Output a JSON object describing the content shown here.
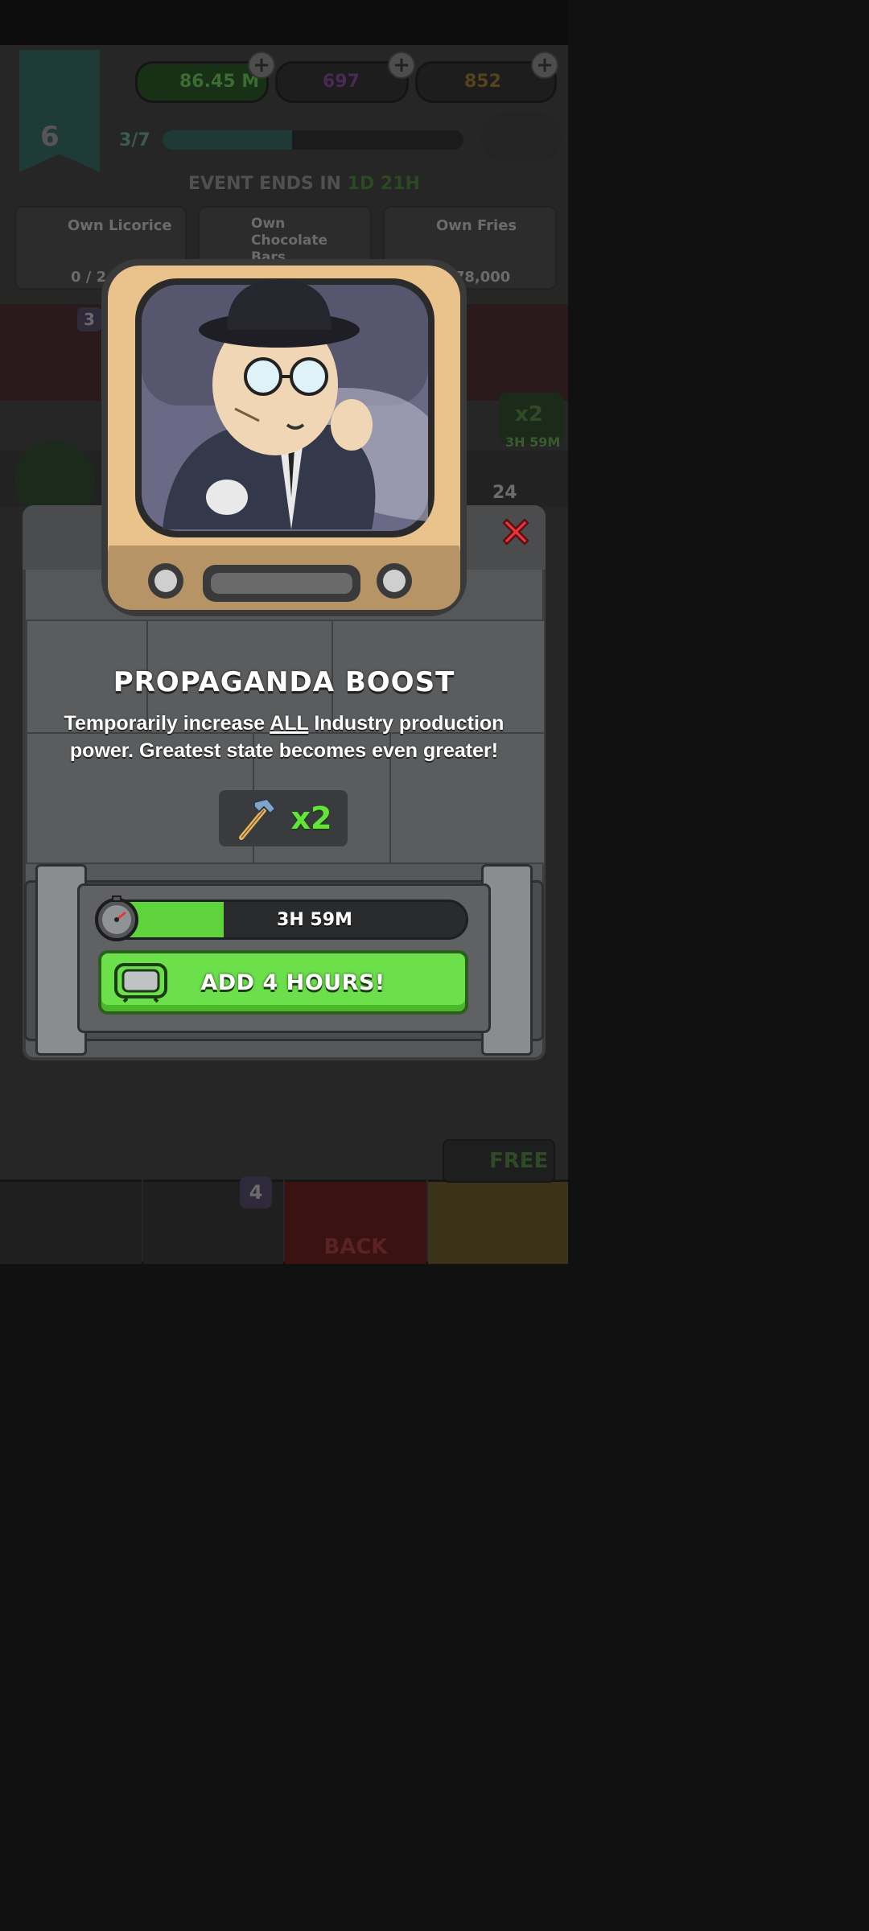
{
  "hud": {
    "level": "6",
    "cash": "86.45 M",
    "potions": "697",
    "gold": "852",
    "progress_text": "3/7",
    "progress_fraction": 0.43
  },
  "event": {
    "label": "EVENT ENDS IN",
    "days": "1D",
    "hours": "21H"
  },
  "tasks": [
    {
      "label": "Own Licorice",
      "progress": "0 / 2"
    },
    {
      "label": "Own Chocolate Bars",
      "progress": ""
    },
    {
      "label": "Own Fries",
      "progress": "/ 78,000"
    }
  ],
  "background_badges": {
    "left_count": "3",
    "boost_badge": "x2",
    "boost_time": "3H 59M",
    "right_count": "24"
  },
  "popup": {
    "title": "PROPAGANDA BOOST",
    "desc_prefix": "Temporarily increase ",
    "desc_emph": "ALL",
    "desc_suffix": " Industry production power. Greatest state becomes even greater!",
    "multiplier": "x2",
    "timer": "3H 59M",
    "timer_fraction": 0.34,
    "add_button": "ADD 4 HOURS!"
  },
  "nav": {
    "cards_badge": "4",
    "back_label": "BACK",
    "free_label": "FREE"
  },
  "colors": {
    "accent_green": "#63e43a",
    "close_red": "#e8343a",
    "tv_frame": "#e9c28c"
  }
}
